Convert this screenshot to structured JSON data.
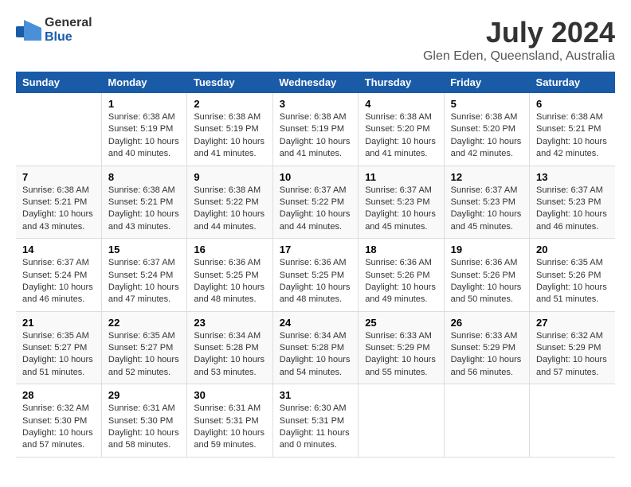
{
  "header": {
    "logo_general": "General",
    "logo_blue": "Blue",
    "month": "July 2024",
    "location": "Glen Eden, Queensland, Australia"
  },
  "days_of_week": [
    "Sunday",
    "Monday",
    "Tuesday",
    "Wednesday",
    "Thursday",
    "Friday",
    "Saturday"
  ],
  "weeks": [
    [
      {
        "day": "",
        "info": ""
      },
      {
        "day": "1",
        "info": "Sunrise: 6:38 AM\nSunset: 5:19 PM\nDaylight: 10 hours\nand 40 minutes."
      },
      {
        "day": "2",
        "info": "Sunrise: 6:38 AM\nSunset: 5:19 PM\nDaylight: 10 hours\nand 41 minutes."
      },
      {
        "day": "3",
        "info": "Sunrise: 6:38 AM\nSunset: 5:19 PM\nDaylight: 10 hours\nand 41 minutes."
      },
      {
        "day": "4",
        "info": "Sunrise: 6:38 AM\nSunset: 5:20 PM\nDaylight: 10 hours\nand 41 minutes."
      },
      {
        "day": "5",
        "info": "Sunrise: 6:38 AM\nSunset: 5:20 PM\nDaylight: 10 hours\nand 42 minutes."
      },
      {
        "day": "6",
        "info": "Sunrise: 6:38 AM\nSunset: 5:21 PM\nDaylight: 10 hours\nand 42 minutes."
      }
    ],
    [
      {
        "day": "7",
        "info": "Sunrise: 6:38 AM\nSunset: 5:21 PM\nDaylight: 10 hours\nand 43 minutes."
      },
      {
        "day": "8",
        "info": "Sunrise: 6:38 AM\nSunset: 5:21 PM\nDaylight: 10 hours\nand 43 minutes."
      },
      {
        "day": "9",
        "info": "Sunrise: 6:38 AM\nSunset: 5:22 PM\nDaylight: 10 hours\nand 44 minutes."
      },
      {
        "day": "10",
        "info": "Sunrise: 6:37 AM\nSunset: 5:22 PM\nDaylight: 10 hours\nand 44 minutes."
      },
      {
        "day": "11",
        "info": "Sunrise: 6:37 AM\nSunset: 5:23 PM\nDaylight: 10 hours\nand 45 minutes."
      },
      {
        "day": "12",
        "info": "Sunrise: 6:37 AM\nSunset: 5:23 PM\nDaylight: 10 hours\nand 45 minutes."
      },
      {
        "day": "13",
        "info": "Sunrise: 6:37 AM\nSunset: 5:23 PM\nDaylight: 10 hours\nand 46 minutes."
      }
    ],
    [
      {
        "day": "14",
        "info": "Sunrise: 6:37 AM\nSunset: 5:24 PM\nDaylight: 10 hours\nand 46 minutes."
      },
      {
        "day": "15",
        "info": "Sunrise: 6:37 AM\nSunset: 5:24 PM\nDaylight: 10 hours\nand 47 minutes."
      },
      {
        "day": "16",
        "info": "Sunrise: 6:36 AM\nSunset: 5:25 PM\nDaylight: 10 hours\nand 48 minutes."
      },
      {
        "day": "17",
        "info": "Sunrise: 6:36 AM\nSunset: 5:25 PM\nDaylight: 10 hours\nand 48 minutes."
      },
      {
        "day": "18",
        "info": "Sunrise: 6:36 AM\nSunset: 5:26 PM\nDaylight: 10 hours\nand 49 minutes."
      },
      {
        "day": "19",
        "info": "Sunrise: 6:36 AM\nSunset: 5:26 PM\nDaylight: 10 hours\nand 50 minutes."
      },
      {
        "day": "20",
        "info": "Sunrise: 6:35 AM\nSunset: 5:26 PM\nDaylight: 10 hours\nand 51 minutes."
      }
    ],
    [
      {
        "day": "21",
        "info": "Sunrise: 6:35 AM\nSunset: 5:27 PM\nDaylight: 10 hours\nand 51 minutes."
      },
      {
        "day": "22",
        "info": "Sunrise: 6:35 AM\nSunset: 5:27 PM\nDaylight: 10 hours\nand 52 minutes."
      },
      {
        "day": "23",
        "info": "Sunrise: 6:34 AM\nSunset: 5:28 PM\nDaylight: 10 hours\nand 53 minutes."
      },
      {
        "day": "24",
        "info": "Sunrise: 6:34 AM\nSunset: 5:28 PM\nDaylight: 10 hours\nand 54 minutes."
      },
      {
        "day": "25",
        "info": "Sunrise: 6:33 AM\nSunset: 5:29 PM\nDaylight: 10 hours\nand 55 minutes."
      },
      {
        "day": "26",
        "info": "Sunrise: 6:33 AM\nSunset: 5:29 PM\nDaylight: 10 hours\nand 56 minutes."
      },
      {
        "day": "27",
        "info": "Sunrise: 6:32 AM\nSunset: 5:29 PM\nDaylight: 10 hours\nand 57 minutes."
      }
    ],
    [
      {
        "day": "28",
        "info": "Sunrise: 6:32 AM\nSunset: 5:30 PM\nDaylight: 10 hours\nand 57 minutes."
      },
      {
        "day": "29",
        "info": "Sunrise: 6:31 AM\nSunset: 5:30 PM\nDaylight: 10 hours\nand 58 minutes."
      },
      {
        "day": "30",
        "info": "Sunrise: 6:31 AM\nSunset: 5:31 PM\nDaylight: 10 hours\nand 59 minutes."
      },
      {
        "day": "31",
        "info": "Sunrise: 6:30 AM\nSunset: 5:31 PM\nDaylight: 11 hours\nand 0 minutes."
      },
      {
        "day": "",
        "info": ""
      },
      {
        "day": "",
        "info": ""
      },
      {
        "day": "",
        "info": ""
      }
    ]
  ]
}
